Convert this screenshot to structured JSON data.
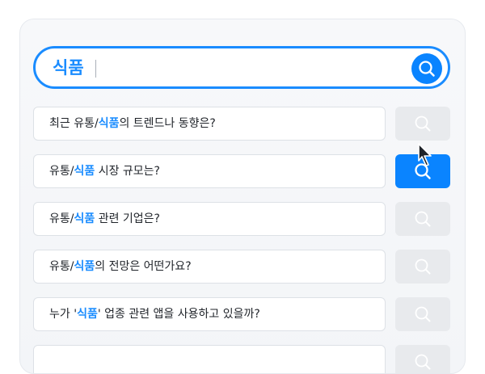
{
  "search": {
    "query": "식품"
  },
  "questions": [
    {
      "before": "최근 유통/",
      "keyword": "식품",
      "after": "의 트렌드나 동향은?",
      "active": false
    },
    {
      "before": "유통/",
      "keyword": "식품",
      "after": " 시장 규모는?",
      "active": true
    },
    {
      "before": "유통/",
      "keyword": "식품",
      "after": " 관련 기업은?",
      "active": false
    },
    {
      "before": "유통/",
      "keyword": "식품",
      "after": "의 전망은 어떤가요?",
      "active": false
    },
    {
      "before": "누가 '",
      "keyword": "식품",
      "after": "' 업종 관련 앱을 사용하고 있을까?",
      "active": false
    }
  ],
  "colors": {
    "accent": "#0a84ff",
    "keyword": "#1a8cff",
    "inactive_button": "#e8eaed"
  },
  "icons": {
    "search": "search-icon",
    "pointer": "mouse-pointer-icon"
  }
}
